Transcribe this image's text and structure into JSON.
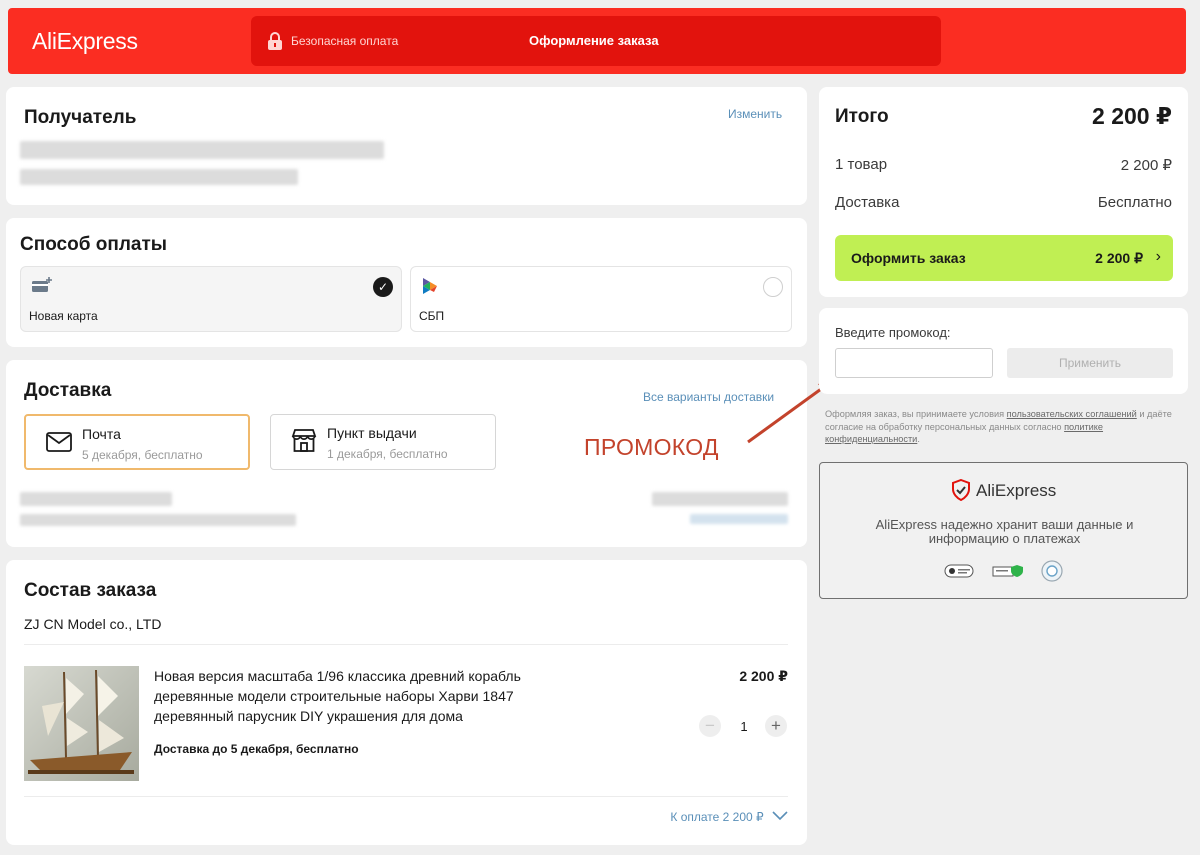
{
  "header": {
    "logo": "AliExpress",
    "secure_label": "Безопасная оплата",
    "title": "Оформление заказа",
    "colors": {
      "bg": "#fb2d22",
      "box": "#e2130d"
    }
  },
  "recipient": {
    "title": "Получатель",
    "edit_label": "Изменить"
  },
  "payment": {
    "title": "Способ оплаты",
    "options": [
      {
        "label": "Новая карта",
        "icon": "card-plus-icon",
        "selected": true
      },
      {
        "label": "СБП",
        "icon": "sbp-icon",
        "selected": false
      }
    ]
  },
  "delivery": {
    "title": "Доставка",
    "all_options_label": "Все варианты доставки",
    "options": [
      {
        "title": "Почта",
        "subtitle": "5 декабря, бесплатно",
        "icon": "envelope-icon",
        "selected": true
      },
      {
        "title": "Пункт выдачи",
        "subtitle": "1 декабря, бесплатно",
        "icon": "store-icon",
        "selected": false
      }
    ]
  },
  "annotation": {
    "label": "ПРОМОКОД",
    "color": "#c3432c"
  },
  "order": {
    "title": "Состав заказа",
    "seller": "ZJ CN Model co., LTD",
    "item": {
      "title_lines": [
        "Новая версия масштаба 1/96 классика древний корабль",
        "деревянные модели строительные наборы Харви 1847",
        "деревянный парусник DIY украшения для дома"
      ],
      "delivery": "Доставка до 5 декабря, бесплатно",
      "price": "2 200 ₽",
      "quantity": "1",
      "minus": "−",
      "plus": "+"
    },
    "to_pay_label": "К оплате 2 200 ₽"
  },
  "summary": {
    "title": "Итого",
    "total": "2 200 ₽",
    "rows": [
      {
        "label": "1 товар",
        "value": "2 200 ₽"
      },
      {
        "label": "Доставка",
        "value": "Бесплатно"
      }
    ],
    "order_button": {
      "label": "Оформить заказ",
      "amount": "2 200 ₽",
      "color": "#c0ef53"
    }
  },
  "promo": {
    "label": "Введите промокод:",
    "placeholder": "",
    "apply_label": "Применить"
  },
  "terms": {
    "part1": "Оформляя заказ, вы принимаете условия ",
    "link1": "пользовательских соглашений",
    "part2": " и даёте согласие на обработку персональных данных согласно ",
    "link2": "политике конфиденциальности",
    "part3": "."
  },
  "trust": {
    "logo": "AliExpress",
    "line1": "AliExpress надежно хранит ваши данные и",
    "line2": "информацию о платежах"
  }
}
